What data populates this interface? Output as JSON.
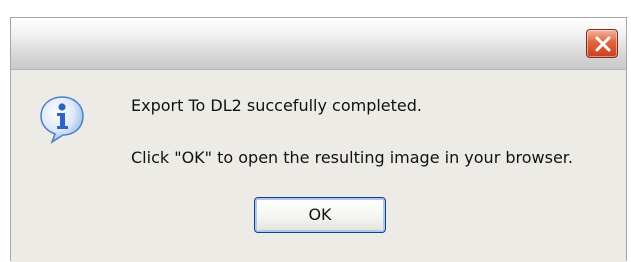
{
  "dialog": {
    "title": "",
    "icon": "info-icon",
    "message_line1": "Export To DL2 succefully completed.",
    "message_line2": "Click \"OK\" to open the resulting image in your browser.",
    "buttons": {
      "ok_label": "OK"
    },
    "close_icon": "close-icon"
  },
  "colors": {
    "dialog_bg": "#ecebe6",
    "close_button": "#d9502b",
    "ok_focus_border": "#1c3a8c",
    "info_icon_blue": "#2a63c9"
  }
}
